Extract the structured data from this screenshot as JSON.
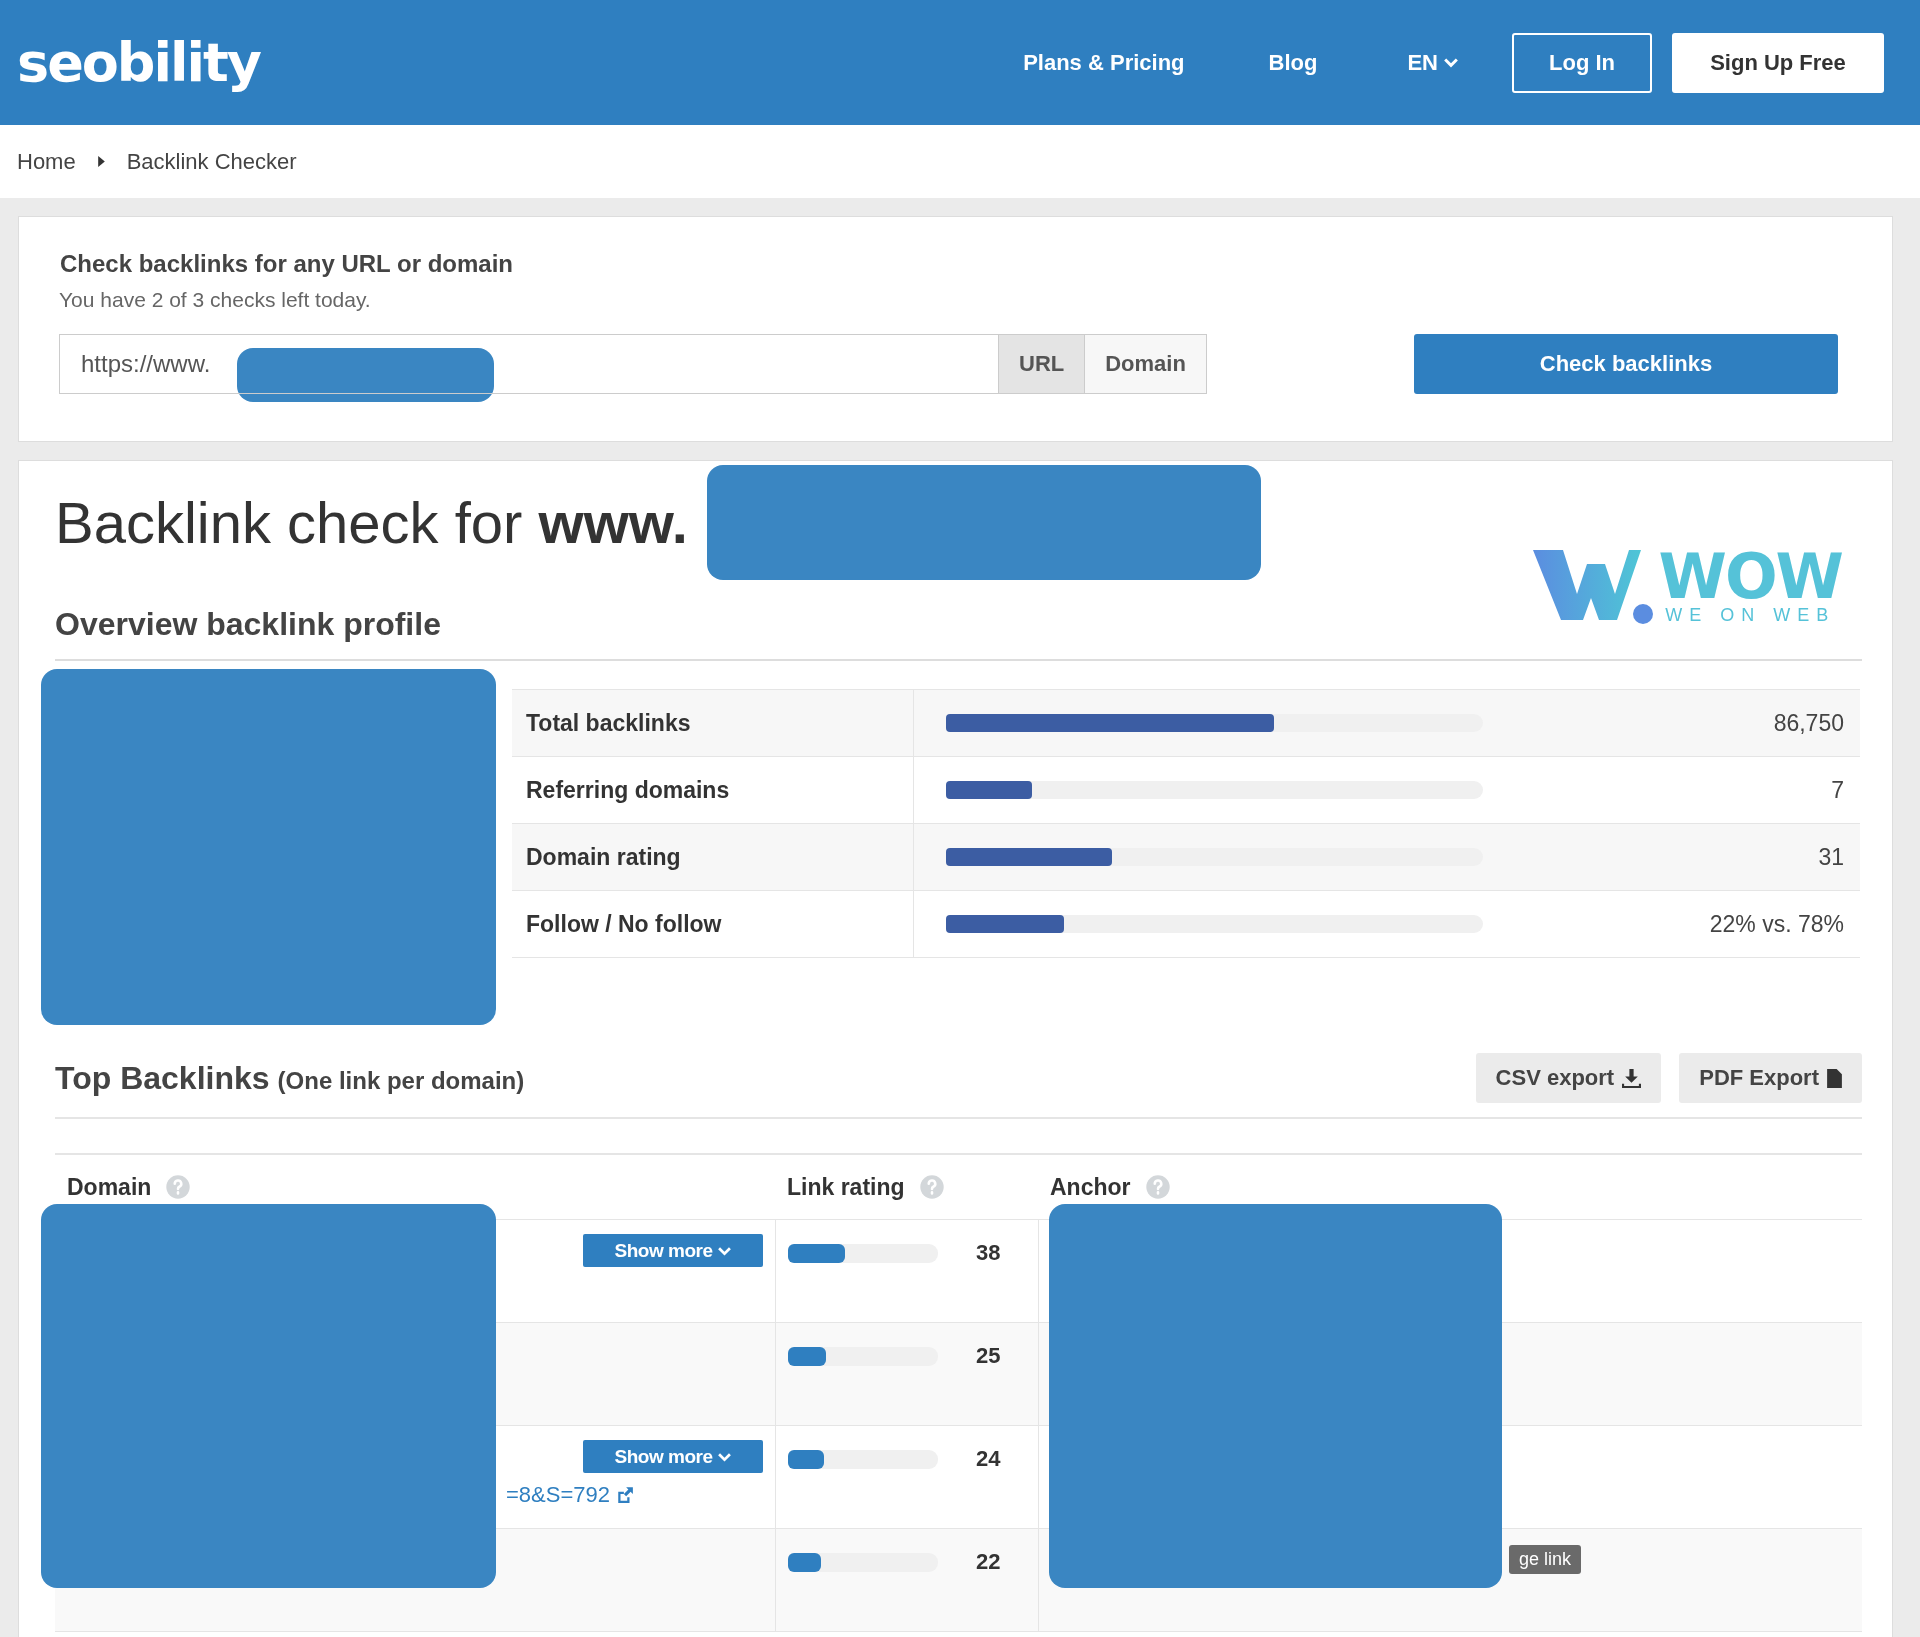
{
  "header": {
    "logo": "seobility",
    "nav": [
      {
        "label": "Plans & Pricing"
      },
      {
        "label": "Blog"
      }
    ],
    "language": "EN",
    "login": "Log In",
    "signup": "Sign Up Free"
  },
  "breadcrumb": [
    "Home",
    "Backlink Checker"
  ],
  "check_form": {
    "title": "Check backlinks for any URL or domain",
    "subtitle": "You have 2 of 3 checks left today.",
    "url_value": "https://www.",
    "modes": [
      {
        "label": "URL",
        "selected": true
      },
      {
        "label": "Domain",
        "selected": false
      }
    ],
    "submit": "Check backlinks"
  },
  "result": {
    "heading_prefix": "Backlink check for ",
    "heading_domain": "www.",
    "logo": {
      "name": "WOW",
      "tagline": "WE ON WEB"
    },
    "overview_title": "Overview backlink profile",
    "metrics": [
      {
        "label": "Total backlinks",
        "level": 0.61,
        "value": "86,750"
      },
      {
        "label": "Referring domains",
        "level": 0.16,
        "value": "7"
      },
      {
        "label": "Domain rating",
        "level": 0.31,
        "value": "31"
      },
      {
        "label": "Follow / No follow",
        "level": 0.22,
        "value": "22% vs. 78%"
      }
    ],
    "top_title": "Top Backlinks",
    "top_subtitle": "(One link per domain)",
    "exports": [
      "CSV export",
      "PDF Export"
    ],
    "columns": [
      "Domain",
      "Link rating",
      "Anchor"
    ],
    "rows": [
      {
        "show_more": "Show more",
        "rating": "38",
        "level": 0.38
      },
      {
        "rating": "25",
        "level": 0.25
      },
      {
        "show_more": "Show more",
        "rating": "24",
        "level": 0.24,
        "url_fragment": "=8&S=792"
      },
      {
        "rating": "22",
        "level": 0.22,
        "badge_fragment": "ge link"
      }
    ]
  }
}
